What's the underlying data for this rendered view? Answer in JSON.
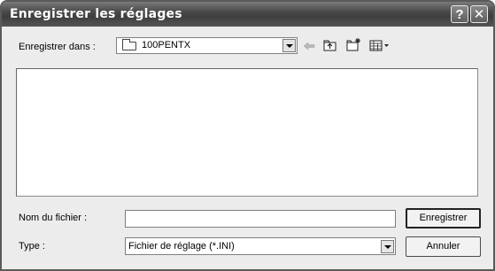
{
  "dialog": {
    "title": "Enregistrer les réglages",
    "help_glyph": "?",
    "close_glyph": "✕"
  },
  "location": {
    "label": "Enregistrer dans :",
    "folder": "100PENTX"
  },
  "toolbar": {
    "icons": [
      "back-arrow-icon",
      "up-folder-icon",
      "new-folder-icon",
      "view-menu-icon"
    ]
  },
  "filename": {
    "label": "Nom du fichier :",
    "value": ""
  },
  "filetype": {
    "label": "Type :",
    "selected": "Fichier de réglage (*.INI)"
  },
  "buttons": {
    "save": "Enregistrer",
    "cancel": "Annuler"
  }
}
